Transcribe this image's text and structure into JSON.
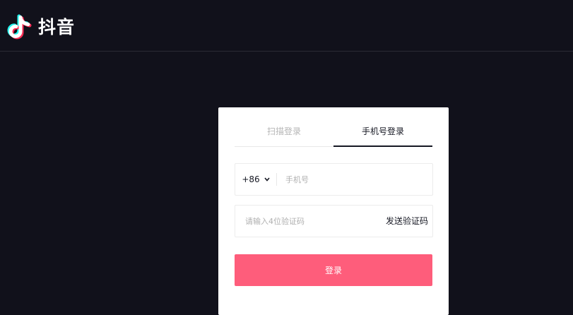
{
  "header": {
    "logo_text": "抖音",
    "logo_icon": "douyin-note-icon"
  },
  "login": {
    "tabs": [
      {
        "label": "扫描登录",
        "active": false
      },
      {
        "label": "手机号登录",
        "active": true
      }
    ],
    "country_code": "+86",
    "phone_placeholder": "手机号",
    "code_placeholder": "请输入4位验证码",
    "send_code_label": "发送验证码",
    "submit_label": "登录",
    "accent_color": "#fe5d7b"
  }
}
